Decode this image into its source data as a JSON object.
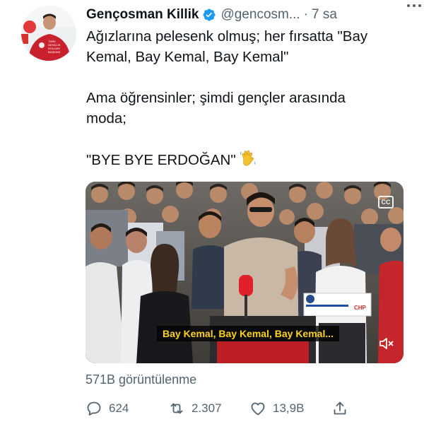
{
  "tweet": {
    "author_name": "Gençosman Killik",
    "handle": "@gencosm...",
    "separator": "·",
    "time": "7 sa",
    "avatar_badge_lines": [
      "TÜRK",
      "GENÇLİK",
      "KOLLARI",
      "BAŞKANI"
    ],
    "lines": [
      "Ağızlarına pelesenk olmuş; her fırsatta \"Bay",
      "Kemal, Bay Kemal, Bay Kemal\"",
      "Ama öğrensinler; şimdi gençler arasında",
      "moda;",
      "\"BYE BYE ERDOĞAN\""
    ],
    "emoji": "waving-hand-icon"
  },
  "media": {
    "caption": "Bay Kemal, Bay Kemal, Bay Kemal...",
    "cc_label": "CC",
    "sign_text": "CHP"
  },
  "views_text": "571B görüntülenme",
  "actions": {
    "reply_count": "624",
    "retweet_count": "2.307",
    "like_count": "13,9B"
  },
  "colors": {
    "text": "#0f1419",
    "secondary": "#536471",
    "verified": "#1d9bf0",
    "caption_text": "#ffd21f"
  }
}
